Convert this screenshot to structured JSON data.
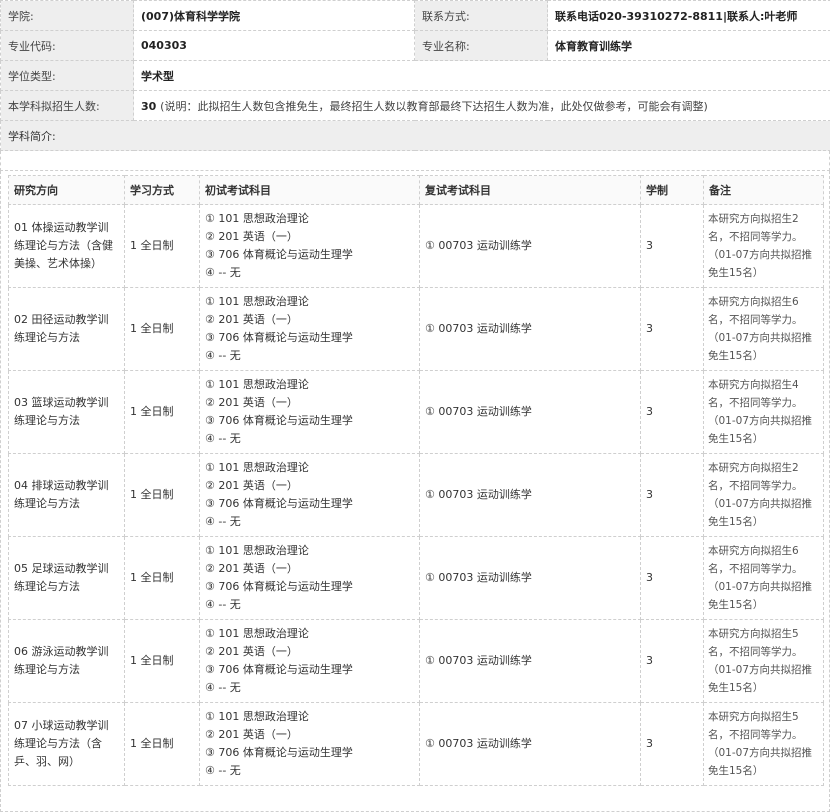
{
  "info": {
    "college_label": "学院:",
    "college_value": "(007)体育科学学院",
    "contact_label": "联系方式:",
    "contact_value": "联系电话020-39310272-8811|联系人:叶老师",
    "code_label": "专业代码:",
    "code_value": "040303",
    "major_label": "专业名称:",
    "major_value": "体育教育训练学",
    "degree_label": "学位类型:",
    "degree_value": "学术型",
    "quota_label": "本学科拟招生人数:",
    "quota_value": "30",
    "quota_note": "(说明：此拟招生人数包含推免生，最终招生人数以教育部最终下达招生人数为准，此处仅做参考，可能会有调整)",
    "intro_label": "学科简介:"
  },
  "table": {
    "headers": [
      "研究方向",
      "学习方式",
      "初试考试科目",
      "复试考试科目",
      "学制",
      "备注"
    ],
    "rows": [
      {
        "direction": "01 体操运动教学训练理论与方法（含健美操、艺术体操）",
        "mode": "1 全日制",
        "subjects": [
          "①  101  思想政治理论",
          "②  201  英语（一）",
          "③  706  体育概论与运动生理学",
          "④  --  无"
        ],
        "retest": "①  00703  运动训练学",
        "years": "3",
        "remark": "本研究方向拟招生2名，不招同等学力。（01-07方向共拟招推免生15名）"
      },
      {
        "direction": "02 田径运动教学训练理论与方法",
        "mode": "1 全日制",
        "subjects": [
          "①  101  思想政治理论",
          "②  201  英语（一）",
          "③  706  体育概论与运动生理学",
          "④  --  无"
        ],
        "retest": "①  00703  运动训练学",
        "years": "3",
        "remark": "本研究方向拟招生6名，不招同等学力。（01-07方向共拟招推免生15名）"
      },
      {
        "direction": "03 篮球运动教学训练理论与方法",
        "mode": "1 全日制",
        "subjects": [
          "①  101  思想政治理论",
          "②  201  英语（一）",
          "③  706  体育概论与运动生理学",
          "④  --  无"
        ],
        "retest": "①  00703  运动训练学",
        "years": "3",
        "remark": "本研究方向拟招生4名，不招同等学力。（01-07方向共拟招推免生15名）"
      },
      {
        "direction": "04 排球运动教学训练理论与方法",
        "mode": "1 全日制",
        "subjects": [
          "①  101  思想政治理论",
          "②  201  英语（一）",
          "③  706  体育概论与运动生理学",
          "④  --  无"
        ],
        "retest": "①  00703  运动训练学",
        "years": "3",
        "remark": "本研究方向拟招生2名，不招同等学力。（01-07方向共拟招推免生15名）"
      },
      {
        "direction": "05 足球运动教学训练理论与方法",
        "mode": "1 全日制",
        "subjects": [
          "①  101  思想政治理论",
          "②  201  英语（一）",
          "③  706  体育概论与运动生理学",
          "④  --  无"
        ],
        "retest": "①  00703  运动训练学",
        "years": "3",
        "remark": "本研究方向拟招生6名，不招同等学力。（01-07方向共拟招推免生15名）"
      },
      {
        "direction": "06 游泳运动教学训练理论与方法",
        "mode": "1 全日制",
        "subjects": [
          "①  101  思想政治理论",
          "②  201  英语（一）",
          "③  706  体育概论与运动生理学",
          "④  --  无"
        ],
        "retest": "①  00703  运动训练学",
        "years": "3",
        "remark": "本研究方向拟招生5名，不招同等学力。（01-07方向共拟招推免生15名）"
      },
      {
        "direction": "07 小球运动教学训练理论与方法（含乒、羽、网）",
        "mode": "1 全日制",
        "subjects": [
          "①  101  思想政治理论",
          "②  201  英语（一）",
          "③  706  体育概论与运动生理学",
          "④  --  无"
        ],
        "retest": "①  00703  运动训练学",
        "years": "3",
        "remark": "本研究方向拟招生5名，不招同等学力。（01-07方向共拟招推免生15名）"
      }
    ]
  }
}
